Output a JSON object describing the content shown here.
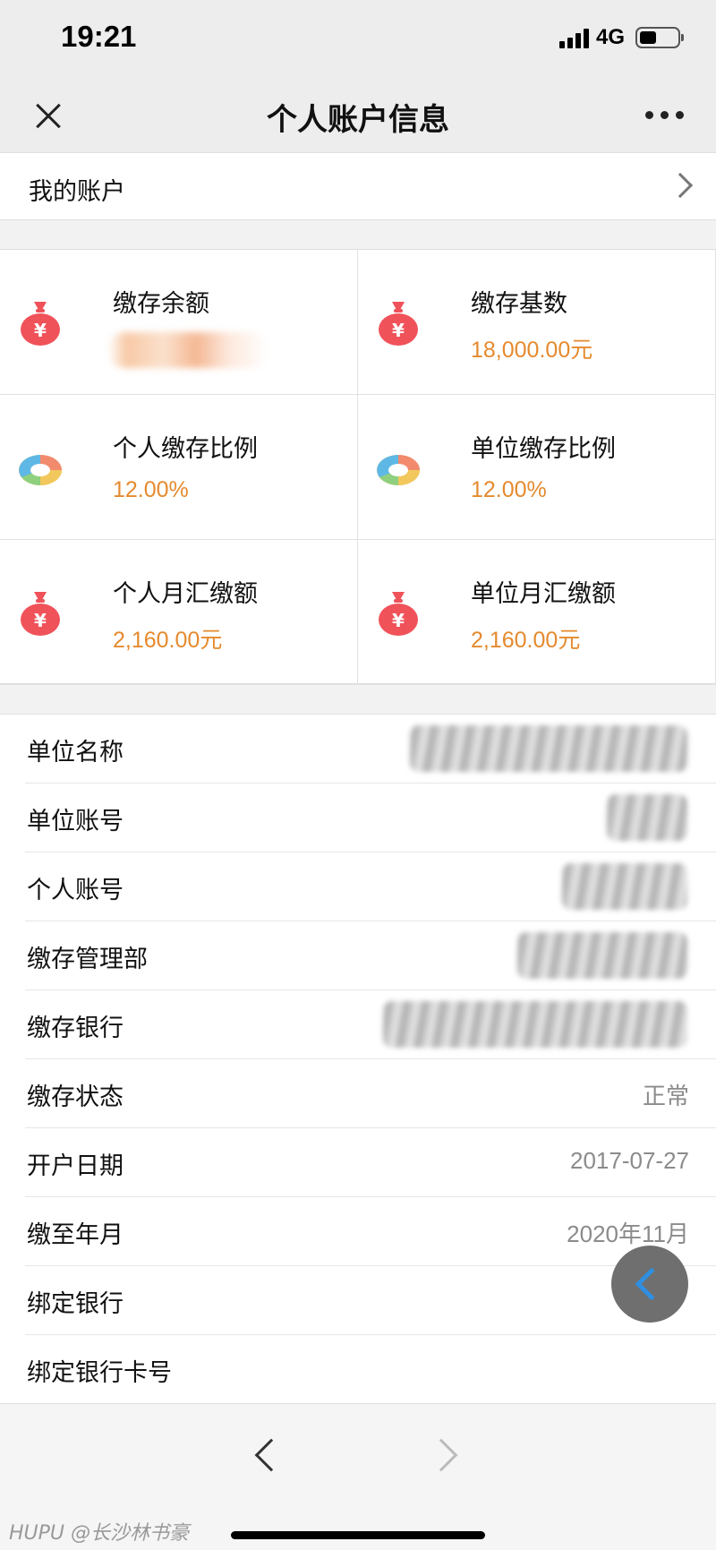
{
  "status_bar": {
    "time": "19:21",
    "network": "4G"
  },
  "nav_bar": {
    "title": "个人账户信息"
  },
  "my_account": {
    "label": "我的账户"
  },
  "summary_cards": [
    {
      "label": "缴存余额",
      "value": "",
      "icon": "money-bag-icon"
    },
    {
      "label": "缴存基数",
      "value": "18,000.00元",
      "icon": "money-bag-icon"
    },
    {
      "label": "个人缴存比例",
      "value": "12.00%",
      "icon": "donut-chart-icon"
    },
    {
      "label": "单位缴存比例",
      "value": "12.00%",
      "icon": "donut-chart-icon"
    },
    {
      "label": "个人月汇缴额",
      "value": "2,160.00元",
      "icon": "money-bag-icon"
    },
    {
      "label": "单位月汇缴额",
      "value": "2,160.00元",
      "icon": "money-bag-icon"
    }
  ],
  "details": [
    {
      "label": "单位名称",
      "value": ""
    },
    {
      "label": "单位账号",
      "value": ""
    },
    {
      "label": "个人账号",
      "value": ""
    },
    {
      "label": "缴存管理部",
      "value": ""
    },
    {
      "label": "缴存银行",
      "value": ""
    },
    {
      "label": "缴存状态",
      "value": "正常"
    },
    {
      "label": "开户日期",
      "value": "2017-07-27"
    },
    {
      "label": "缴至年月",
      "value": "2020年11月"
    },
    {
      "label": "绑定银行",
      "value": ""
    },
    {
      "label": "绑定银行卡号",
      "value": ""
    }
  ],
  "watermark": "HUPU @长沙林书豪",
  "colors": {
    "accent_value": "#e58a2e",
    "icon_red": "#f0525a",
    "float_button_arrow": "#2f8fe0"
  }
}
